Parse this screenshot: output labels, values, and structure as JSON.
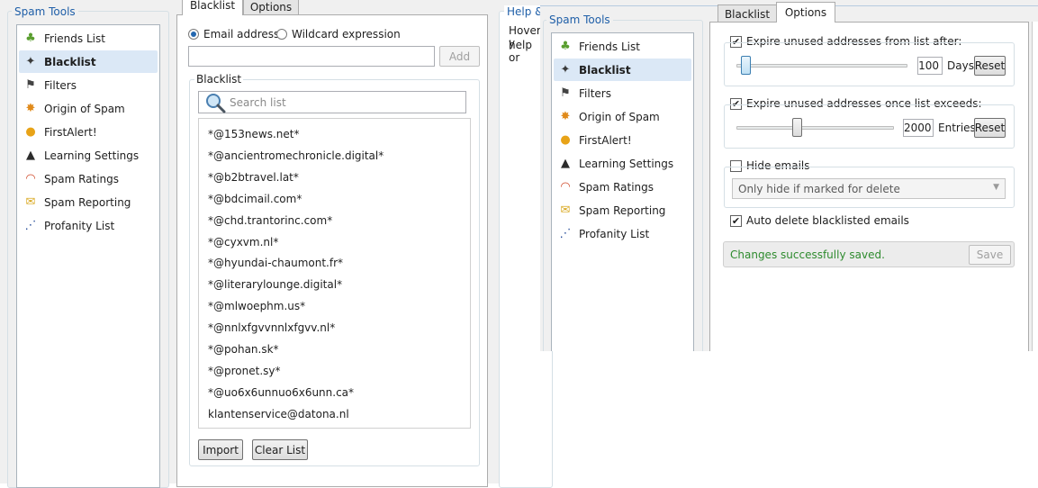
{
  "left": {
    "spam_tools_title": "Spam Tools",
    "nav": [
      {
        "label": "Friends List",
        "icon": "friends-icon"
      },
      {
        "label": "Blacklist",
        "icon": "blacklist-icon",
        "selected": true
      },
      {
        "label": "Filters",
        "icon": "filters-icon"
      },
      {
        "label": "Origin of Spam",
        "icon": "origin-icon"
      },
      {
        "label": "FirstAlert!",
        "icon": "firstalert-icon"
      },
      {
        "label": "Learning Settings",
        "icon": "learning-icon"
      },
      {
        "label": "Spam Ratings",
        "icon": "ratings-icon"
      },
      {
        "label": "Spam Reporting",
        "icon": "reporting-icon"
      },
      {
        "label": "Profanity List",
        "icon": "profanity-icon"
      }
    ],
    "tabs": [
      "Blacklist",
      "Options"
    ],
    "active_tab": "Blacklist",
    "radio_email": "Email address",
    "radio_wildcard": "Wildcard expression",
    "entry_value": "",
    "add_button": "Add",
    "blacklist_group": "Blacklist",
    "search_placeholder": "Search list",
    "list": [
      "*@153news.net*",
      "*@ancientromechronicle.digital*",
      "*@b2btravel.lat*",
      "*@bdcimail.com*",
      "*@chd.trantorinc.com*",
      "*@cyxvm.nl*",
      "*@hyundai-chaumont.fr*",
      "*@literarylounge.digital*",
      "*@mlwoephm.us*",
      "*@nnlxfgvvnnlxfgvv.nl*",
      "*@pohan.sk*",
      "*@pronet.sy*",
      "*@uo6x6unnuo6x6unn.ca*",
      "klantenservice@datona.nl"
    ],
    "import_button": "Import",
    "clear_button": "Clear List",
    "help_title": "Help &",
    "help_text_1": "Hover y",
    "help_text_2": "help or"
  },
  "right": {
    "spam_tools_title": "Spam Tools",
    "tabs": [
      "Blacklist",
      "Options"
    ],
    "active_tab": "Options",
    "expire_after_label": "Expire unused addresses from list after:",
    "expire_after_value": "100",
    "expire_after_unit": "Days",
    "expire_after_level": 0.05,
    "expire_exceeds_label": "Expire unused addresses once list exceeds:",
    "expire_exceeds_value": "2000",
    "expire_exceeds_unit": "Entries",
    "expire_exceeds_level": 0.38,
    "reset_button": "Reset",
    "hide_emails_label": "Hide emails",
    "hide_emails_option": "Only hide if marked for delete",
    "auto_delete_label": "Auto delete blacklisted emails",
    "status_text": "Changes successfully saved.",
    "save_button": "Save"
  },
  "colors": {
    "title_blue": "#1f5fa8",
    "selected_bg": "#dbe8f6",
    "success_green": "#2e8b2e"
  }
}
